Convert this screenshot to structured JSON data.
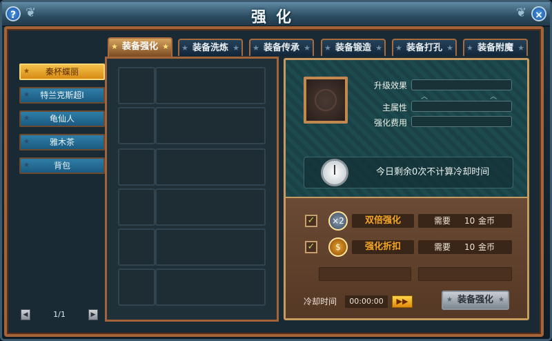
{
  "window": {
    "title": "强化"
  },
  "titlebar": {
    "help_icon": "question-mark-icon",
    "close_icon": "close-icon"
  },
  "tabs": [
    {
      "label": "装备强化",
      "active": true
    },
    {
      "label": "装备洗炼",
      "active": false
    },
    {
      "label": "装备传承",
      "active": false
    },
    {
      "label": "装备锻造",
      "active": false
    },
    {
      "label": "装备打孔",
      "active": false
    },
    {
      "label": "装备附魔",
      "active": false
    }
  ],
  "characters": [
    {
      "label": "秦杯蝶丽",
      "active": true
    },
    {
      "label": "特兰克斯超Ⅰ",
      "active": false
    },
    {
      "label": "龟仙人",
      "active": false
    },
    {
      "label": "雅木茶",
      "active": false
    },
    {
      "label": "背包",
      "active": false
    }
  ],
  "pager": {
    "text": "1/1",
    "prev_icon": "arrow-left-icon",
    "next_icon": "arrow-right-icon"
  },
  "enhance": {
    "upgrade_effect_label": "升级效果",
    "main_attr_label": "主属性",
    "cost_label": "强化费用",
    "hint": "今日剩余0次不计算冷却时间",
    "clock_icon": "clock-icon"
  },
  "options": [
    {
      "name": "双倍强化",
      "icon": "double-x2-icon",
      "icon_text": "×2",
      "need": "需要",
      "amount": "10",
      "currency": "金币"
    },
    {
      "name": "强化折扣",
      "icon": "discount-coin-icon",
      "icon_text": "$",
      "need": "需要",
      "amount": "10",
      "currency": "金币"
    }
  ],
  "cooldown": {
    "label": "冷却时间",
    "time": "00:00:00",
    "skip_icon": "fast-forward-icon",
    "skip_text": "▶▶"
  },
  "action": {
    "label": "装备强化"
  },
  "colors": {
    "accent_orange": "#f5a623",
    "frame_brown": "#a3643a",
    "teal": "#1d4a4e"
  }
}
